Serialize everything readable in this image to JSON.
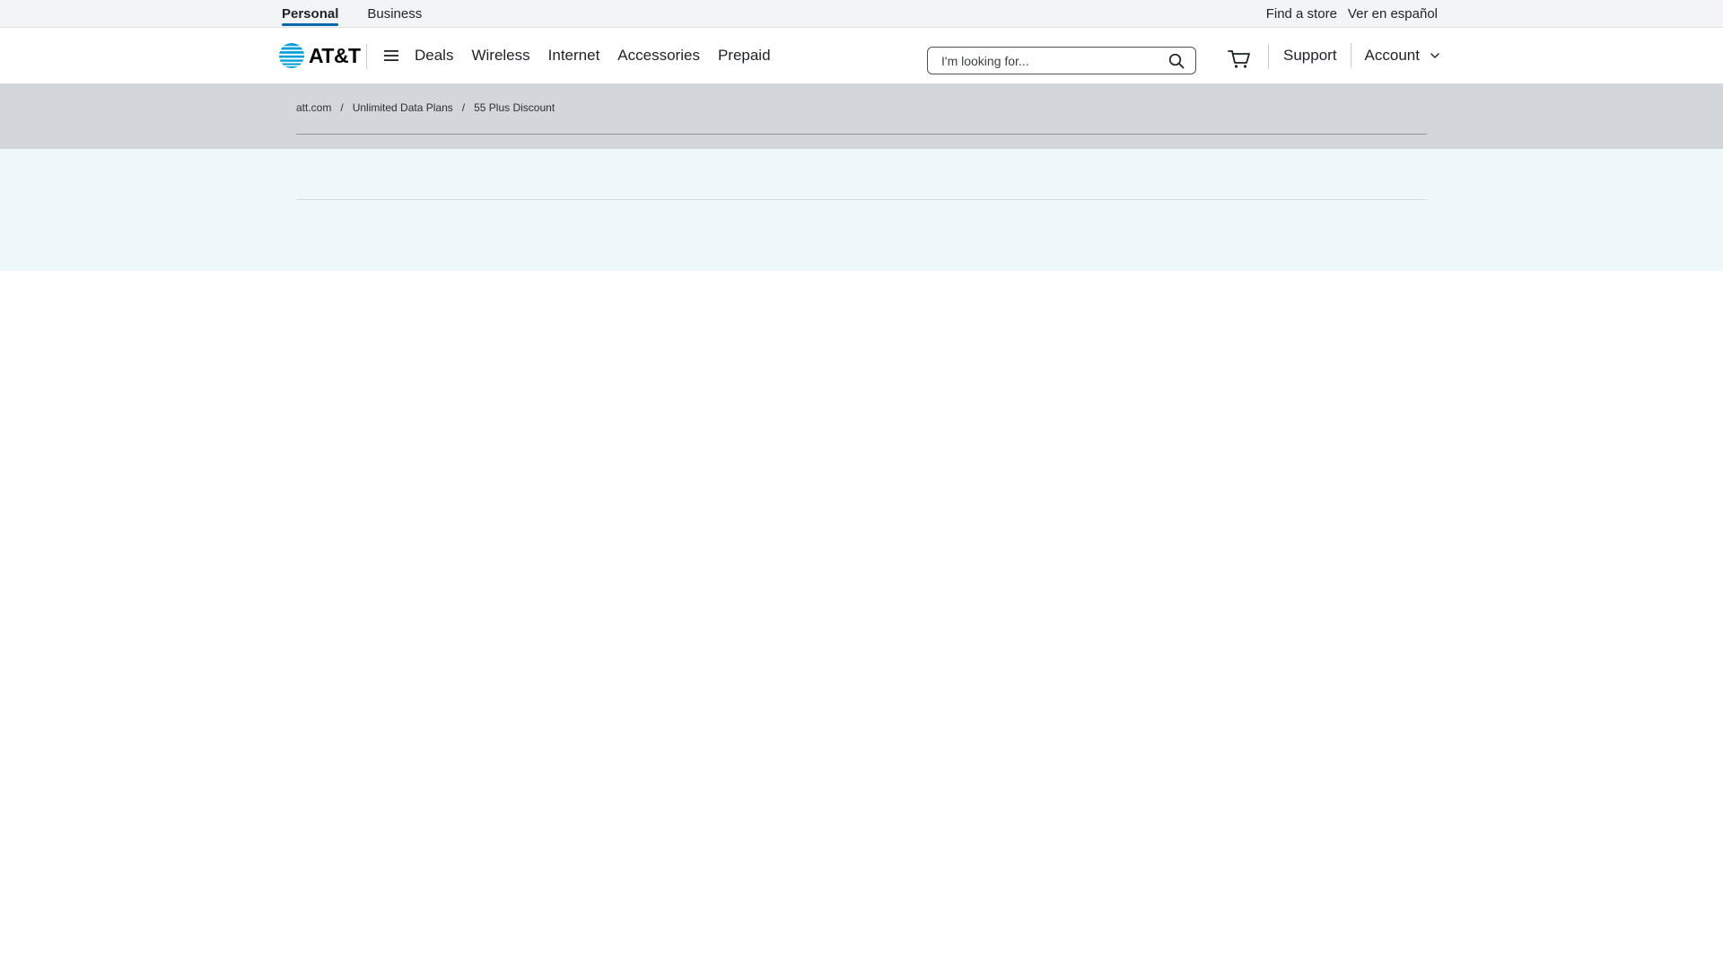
{
  "utility": {
    "left_links": [
      {
        "label": "Personal",
        "active": true
      },
      {
        "label": "Business",
        "active": false
      }
    ],
    "right_links": [
      {
        "label": "Find a store"
      },
      {
        "label": "Ver en español"
      }
    ]
  },
  "header": {
    "logo_text": "AT&T",
    "nav": [
      "Deals",
      "Wireless",
      "Internet",
      "Accessories",
      "Prepaid"
    ],
    "search": {
      "placeholder": "I'm looking for...",
      "value": ""
    },
    "support_label": "Support",
    "account_label": "Account"
  },
  "breadcrumb": [
    "att.com",
    "Unlimited Data Plans",
    "55 Plus Discount"
  ],
  "icons": {
    "logo": "att-globe-icon",
    "menu": "hamburger-menu-icon",
    "search": "search-icon",
    "cart": "cart-icon",
    "account_chevron": "chevron-down-icon"
  },
  "colors": {
    "brand_blue": "#009fdb",
    "active_underline": "#0568ae",
    "breadcrumb_band": "#d3d6da",
    "hero_band": "#eef7f9"
  }
}
